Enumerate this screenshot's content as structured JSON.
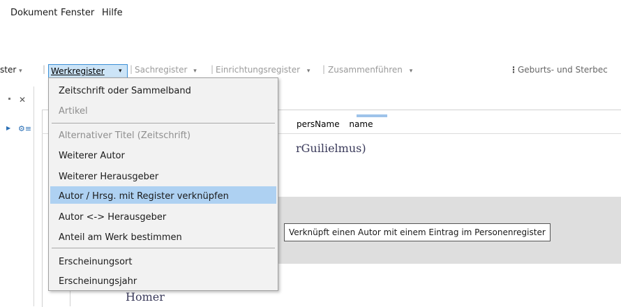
{
  "menubar": {
    "items": [
      {
        "label": "Dokument"
      },
      {
        "label": "Fenster"
      },
      {
        "label": "Hilfe"
      }
    ]
  },
  "toolbar": {
    "prev_register_label": "ster",
    "werkregister_label": "Werkregister",
    "sachregister_label": "Sachregister",
    "einrichtungsregister_label": "Einrichtungsregister",
    "zusammenfuehren_label": "Zusammenführen",
    "geburts_label": "Geburts- und Sterbec",
    "separator": "|",
    "caret": "▾"
  },
  "editor": {
    "tags": [
      "persName",
      "name"
    ],
    "line1": "rGuilielmus)",
    "line_bottom": "Homer"
  },
  "dropdown": {
    "items": [
      {
        "label": "Zeitschrift oder Sammelband",
        "enabled": true
      },
      {
        "label": "Artikel",
        "enabled": false
      },
      {
        "label": "Alternativer Titel (Zeitschrift)",
        "enabled": false
      },
      {
        "label": "Weiterer Autor",
        "enabled": true
      },
      {
        "label": "Weiterer Herausgeber",
        "enabled": true
      },
      {
        "label": "Autor / Hrsg. mit Register verknüpfen",
        "enabled": true,
        "highlighted": true
      },
      {
        "label": "Autor <-> Herausgeber",
        "enabled": true
      },
      {
        "label": "Anteil am Werk bestimmen",
        "enabled": true
      },
      {
        "label": "Erscheinungsort",
        "enabled": true
      },
      {
        "label": "Erscheinungsjahr",
        "enabled": true
      }
    ]
  },
  "tooltip": {
    "text": "Verknüpft einen Autor mit einem Eintrag im Personenregister"
  },
  "colors": {
    "highlight": "#aed1f2",
    "button_active": "#cce4f7",
    "button_border": "#3a8fd6",
    "disabled_text": "#8e8e8e"
  }
}
